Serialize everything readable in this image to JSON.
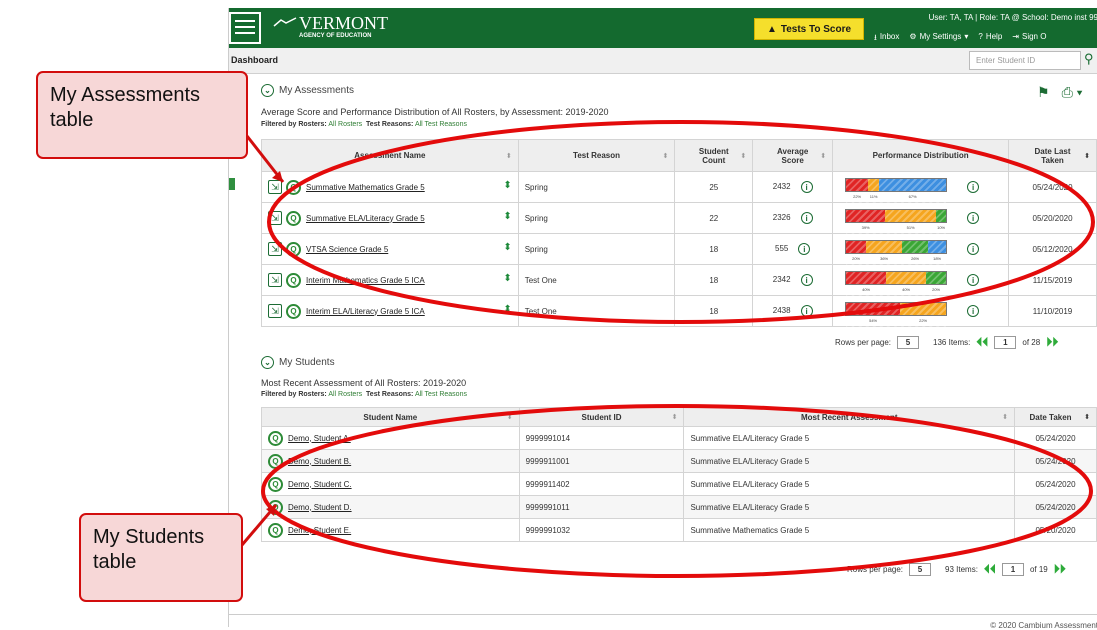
{
  "header": {
    "logo_name": "VERMONT",
    "logo_sub": "AGENCY OF EDUCATION",
    "tests_to_score": "Tests To Score",
    "user_line": "User: TA, TA | Role: TA @ School: Demo inst 99",
    "inbox": "Inbox",
    "my_settings": "My Settings",
    "help": "Help",
    "sign_out": "Sign O"
  },
  "subbar": {
    "title": "Dashboard",
    "search_placeholder": "Enter Student ID"
  },
  "assessments": {
    "section_title": "My Assessments",
    "subtitle": "Average Score and Performance Distribution of All Rosters, by Assessment: 2019-2020",
    "filter_rosters_label": "Filtered by Rosters:",
    "filter_rosters_value": "All Rosters",
    "filter_reasons_label": "Test Reasons:",
    "filter_reasons_value": "All Test Reasons",
    "columns": {
      "name": "Assessment Name",
      "reason": "Test Reason",
      "count": "Student Count",
      "score": "Average Score",
      "perf": "Performance Distribution",
      "date": "Date Last Taken"
    },
    "rows": [
      {
        "name": "Summative Mathematics Grade 5",
        "reason": "Spring",
        "count": "25",
        "score": "2432",
        "date": "05/24/2020",
        "segments": [
          {
            "v": 22,
            "c": "#e02424",
            "l": "22%"
          },
          {
            "v": 11,
            "c": "#f5a51e",
            "l": "11%"
          },
          {
            "v": 67,
            "c": "#3d8fe0",
            "l": "67%"
          }
        ]
      },
      {
        "name": "Summative ELA/Literacy Grade 5",
        "reason": "Spring",
        "count": "22",
        "score": "2326",
        "date": "05/20/2020",
        "segments": [
          {
            "v": 39,
            "c": "#e02424",
            "l": "39%"
          },
          {
            "v": 51,
            "c": "#f5a51e",
            "l": "51%"
          },
          {
            "v": 10,
            "c": "#3aa635",
            "l": "10%"
          }
        ]
      },
      {
        "name": "VTSA Science Grade 5",
        "reason": "Spring",
        "count": "18",
        "score": "555",
        "date": "05/12/2020",
        "segments": [
          {
            "v": 20,
            "c": "#e02424",
            "l": "20%"
          },
          {
            "v": 36,
            "c": "#f5a51e",
            "l": "36%"
          },
          {
            "v": 26,
            "c": "#3aa635",
            "l": "26%"
          },
          {
            "v": 18,
            "c": "#3d8fe0",
            "l": "18%"
          }
        ]
      },
      {
        "name": "Interim Mathematics Grade 5 ICA",
        "reason": "Test One",
        "count": "18",
        "score": "2342",
        "date": "11/15/2019",
        "segments": [
          {
            "v": 40,
            "c": "#e02424",
            "l": "40%"
          },
          {
            "v": 40,
            "c": "#f5a51e",
            "l": "40%"
          },
          {
            "v": 20,
            "c": "#3aa635",
            "l": "20%"
          }
        ]
      },
      {
        "name": "Interim ELA/Literacy Grade 5 ICA",
        "reason": "Test One",
        "count": "18",
        "score": "2438",
        "date": "11/10/2019",
        "segments": [
          {
            "v": 54,
            "c": "#e02424",
            "l": "54%"
          },
          {
            "v": 46,
            "c": "#f5a51e",
            "l": "22%"
          }
        ]
      }
    ],
    "pager": {
      "rows_label": "Rows per page:",
      "rows_value": "5",
      "items": "136 Items:",
      "page": "1",
      "of": "of 28"
    }
  },
  "students": {
    "section_title": "My Students",
    "subtitle": "Most Recent Assessment of All Rosters: 2019-2020",
    "filter_rosters_label": "Filtered by Rosters:",
    "filter_rosters_value": "All Rosters",
    "filter_reasons_label": "Test Reasons:",
    "filter_reasons_value": "All Test Reasons",
    "columns": {
      "name": "Student Name",
      "id": "Student ID",
      "recent": "Most Recent Assessment",
      "date": "Date Taken"
    },
    "rows": [
      {
        "name": "Demo, Student A.",
        "id": "9999991014",
        "recent": "Summative ELA/Literacy Grade 5",
        "date": "05/24/2020"
      },
      {
        "name": "Demo, Student B.",
        "id": "9999911001",
        "recent": "Summative ELA/Literacy Grade 5",
        "date": "05/24/2020"
      },
      {
        "name": "Demo, Student C.",
        "id": "9999911402",
        "recent": "Summative ELA/Literacy Grade 5",
        "date": "05/24/2020"
      },
      {
        "name": "Demo, Student D.",
        "id": "9999991011",
        "recent": "Summative ELA/Literacy Grade 5",
        "date": "05/24/2020"
      },
      {
        "name": "Demo, Student E.",
        "id": "9999991032",
        "recent": "Summative Mathematics Grade 5",
        "date": "05/20/2020"
      }
    ],
    "pager": {
      "rows_label": "Rows per page:",
      "rows_value": "5",
      "items": "93 Items:",
      "page": "1",
      "of": "of 19"
    }
  },
  "footer": "© 2020 Cambium Assessment",
  "annotations": {
    "assessments_callout": "My Assessments table",
    "students_callout": "My Students table"
  },
  "colors": {
    "brand_green": "#146a2f",
    "accent_yellow": "#f5df2c",
    "callout_red": "#d20d0d"
  }
}
